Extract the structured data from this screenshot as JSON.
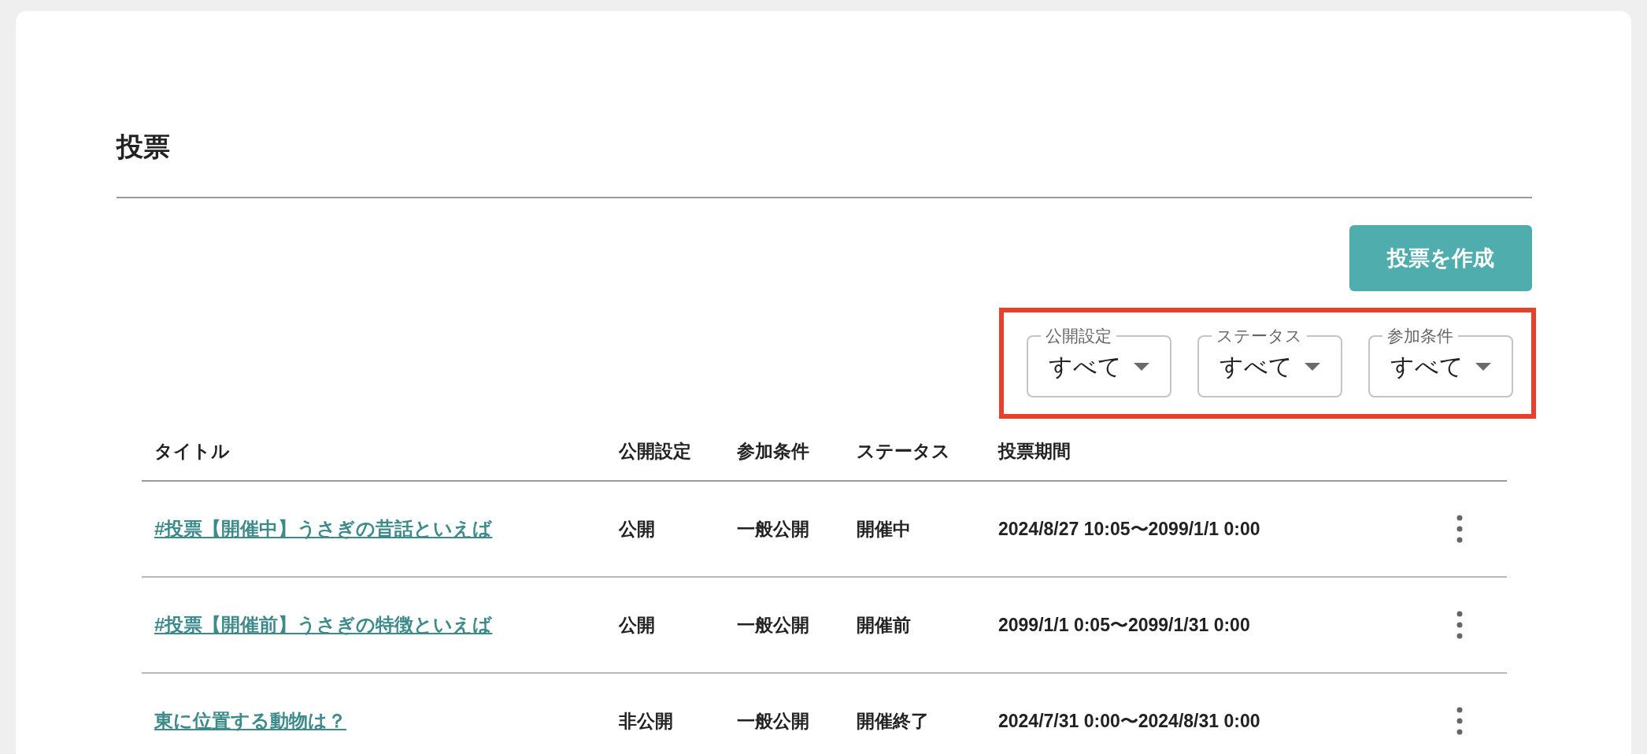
{
  "page": {
    "title": "投票"
  },
  "create_button": {
    "label": "投票を作成"
  },
  "filters": [
    {
      "label": "公開設定",
      "value": "すべて"
    },
    {
      "label": "ステータス",
      "value": "すべて"
    },
    {
      "label": "参加条件",
      "value": "すべて"
    }
  ],
  "table": {
    "columns": [
      "タイトル",
      "公開設定",
      "参加条件",
      "ステータス",
      "投票期間"
    ],
    "rows": [
      {
        "title": "#投票【開催中】うさぎの昔話といえば",
        "visibility": "公開",
        "condition": "一般公開",
        "status": "開催中",
        "period": "2024/8/27 10:05〜2099/1/1 0:00"
      },
      {
        "title": "#投票【開催前】うさぎの特徴といえば",
        "visibility": "公開",
        "condition": "一般公開",
        "status": "開催前",
        "period": "2099/1/1 0:05〜2099/1/31 0:00"
      },
      {
        "title": "東に位置する動物は？",
        "visibility": "非公開",
        "condition": "一般公開",
        "status": "開催終了",
        "period": "2024/7/31 0:00〜2024/8/31 0:00"
      }
    ]
  }
}
